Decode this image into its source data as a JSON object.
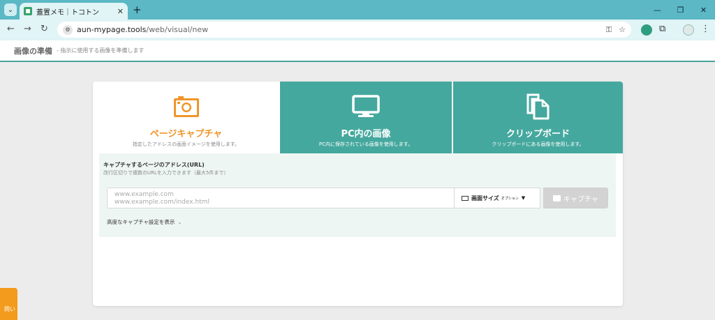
{
  "browser": {
    "tab_title": "蓋置メモ｜トコトン",
    "url_domain": "aun-mypage.tools",
    "url_path": "/web/visual/new",
    "icons": [
      "tab-menu-icon",
      "close-icon",
      "plus-icon",
      "minimize-icon",
      "restore-icon",
      "close-window-icon",
      "back-icon",
      "forward-icon",
      "reload-icon",
      "key-icon",
      "star-icon",
      "puzzle-icon"
    ]
  },
  "header": {
    "title": "画像の準備",
    "subtitle": "- 指示に使用する画像を準備します"
  },
  "source_tabs": [
    {
      "label": "ページキャプチャ",
      "desc": "指定したアドレスの画面イメージを使用します。",
      "active": true,
      "icon": "camera-icon"
    },
    {
      "label": "PC内の画像",
      "desc": "PC内に保存されている画像を使用します。",
      "active": false,
      "icon": "monitor-icon"
    },
    {
      "label": "クリップボード",
      "desc": "クリップボードにある画像を使用します。",
      "active": false,
      "icon": "clipboard-icon"
    }
  ],
  "form": {
    "label": "キャプチャするページのアドレス(URL)",
    "hint": "改行区切りで複数のURLを入力できます（最大5件まで）",
    "placeholder": "www.example.com\nwww.example.com/index.html",
    "size_label": "画面サイズ",
    "size_option": "オプション",
    "capture_label": "キャプチャ",
    "advanced_label": "高度なキャプチャ設定を表示"
  },
  "side_tab": "問い",
  "colors": {
    "accent": "#45a89e",
    "orange": "#f0962a",
    "side": "#f39b1c"
  }
}
